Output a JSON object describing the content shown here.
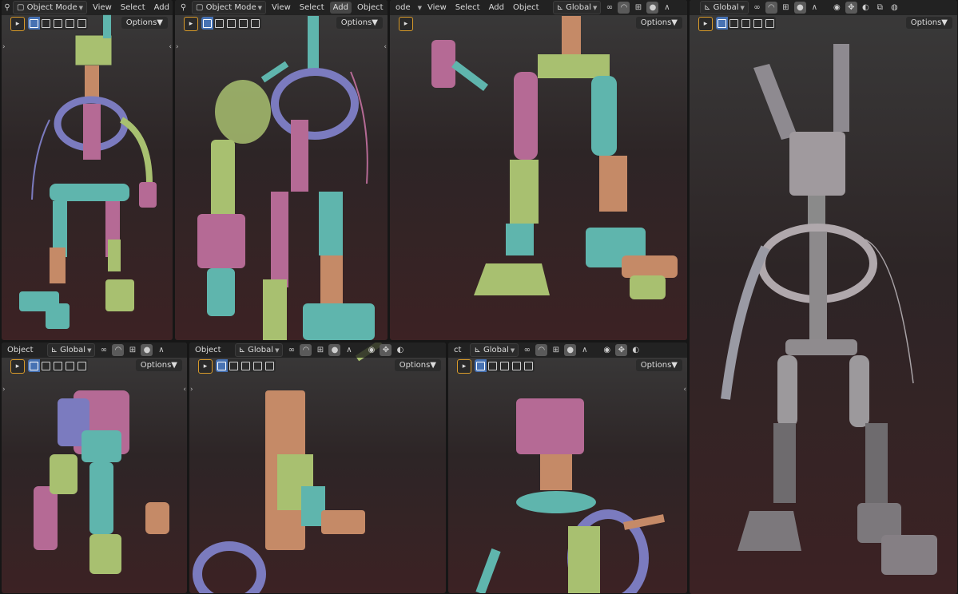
{
  "header_items": {
    "object_mode": "Object Mode",
    "view": "View",
    "select": "Select",
    "add": "Add",
    "object": "Object",
    "global": "Global",
    "options": "Options",
    "ode": "ode",
    "ct": "ct"
  },
  "colors": {
    "mesh_teal": "#5fb5ad",
    "mesh_purple": "#7b7bbf",
    "mesh_pink": "#b56a95",
    "mesh_green": "#a8c070",
    "mesh_orange": "#c58a67",
    "mesh_grey": "#9a9aa4",
    "active_blue": "#4772b3",
    "tool_orange": "#d89a2a"
  },
  "icons": [
    "editor-type-icon",
    "mode-icon",
    "orientation-icon",
    "link-icon",
    "snap-icon",
    "snap-increment-icon",
    "proportional-icon",
    "falloff-icon",
    "visibility-icon",
    "gizmo-icon",
    "overlay-icon",
    "xray-icon",
    "shading-icon",
    "select-box-icon"
  ]
}
